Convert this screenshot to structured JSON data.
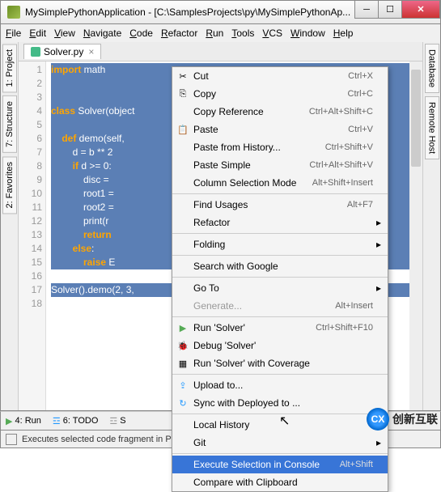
{
  "title": "MySimplePythonApplication - [C:\\SamplesProjects\\py\\MySimplePythonAp...",
  "menu": [
    "File",
    "Edit",
    "View",
    "Navigate",
    "Code",
    "Refactor",
    "Run",
    "Tools",
    "VCS",
    "Window",
    "Help"
  ],
  "tab_file": "Solver.py",
  "left_tabs": [
    "1: Project",
    "7: Structure",
    "2: Favorites"
  ],
  "right_tabs": [
    "Database",
    "Remote Host"
  ],
  "line_numbers": [
    "1",
    "2",
    "3",
    "4",
    "5",
    "6",
    "7",
    "8",
    "9",
    "10",
    "11",
    "12",
    "13",
    "14",
    "15",
    "16",
    "17",
    "18"
  ],
  "code_lines": [
    "import math",
    "",
    "",
    "class Solver(object",
    "",
    "    def demo(self,",
    "        d = b ** 2",
    "        if d >= 0:",
    "            disc =",
    "            root1 =",
    "            root2 =",
    "            print(r",
    "            return",
    "        else:",
    "            raise E",
    "",
    "Solver().demo(2, 3,",
    ""
  ],
  "bottom": {
    "run": "4: Run",
    "todo": "6: TODO",
    "sh": "S"
  },
  "status": "Executes selected code fragment in P",
  "ctx": [
    {
      "icon": "✂",
      "label": "Cut",
      "shortcut": "Ctrl+X",
      "u": ""
    },
    {
      "icon": "⎘",
      "label": "Copy",
      "shortcut": "Ctrl+C"
    },
    {
      "icon": "",
      "label": "Copy Reference",
      "shortcut": "Ctrl+Alt+Shift+C"
    },
    {
      "icon": "📋",
      "label": "Paste",
      "shortcut": "Ctrl+V"
    },
    {
      "icon": "",
      "label": "Paste from History...",
      "shortcut": "Ctrl+Shift+V"
    },
    {
      "icon": "",
      "label": "Paste Simple",
      "shortcut": "Ctrl+Alt+Shift+V"
    },
    {
      "icon": "",
      "label": "Column Selection Mode",
      "shortcut": "Alt+Shift+Insert"
    },
    {
      "sep": true
    },
    {
      "icon": "",
      "label": "Find Usages",
      "shortcut": "Alt+F7"
    },
    {
      "icon": "",
      "label": "Refactor",
      "sub": true
    },
    {
      "sep": true
    },
    {
      "icon": "",
      "label": "Folding",
      "sub": true
    },
    {
      "sep": true
    },
    {
      "icon": "",
      "label": "Search with Google"
    },
    {
      "sep": true
    },
    {
      "icon": "",
      "label": "Go To",
      "sub": true
    },
    {
      "icon": "",
      "label": "Generate...",
      "shortcut": "Alt+Insert",
      "disabled": true
    },
    {
      "sep": true
    },
    {
      "icon": "▶",
      "label": "Run 'Solver'",
      "shortcut": "Ctrl+Shift+F10",
      "iconColor": "#5a5"
    },
    {
      "icon": "🐞",
      "label": "Debug 'Solver'"
    },
    {
      "icon": "▦",
      "label": "Run 'Solver' with Coverage"
    },
    {
      "sep": true
    },
    {
      "icon": "⇪",
      "label": "Upload to...",
      "iconColor": "#29f"
    },
    {
      "icon": "↻",
      "label": "Sync with Deployed to ...",
      "iconColor": "#29f"
    },
    {
      "sep": true
    },
    {
      "icon": "",
      "label": "Local History",
      "sub": true
    },
    {
      "icon": "",
      "label": "Git",
      "sub": true
    },
    {
      "sep": true
    },
    {
      "icon": "",
      "label": "Execute Selection in Console",
      "shortcut": "Alt+Shift",
      "highlight": true
    },
    {
      "icon": "",
      "label": "Compare with Clipboard"
    }
  ],
  "watermark": "创新互联"
}
